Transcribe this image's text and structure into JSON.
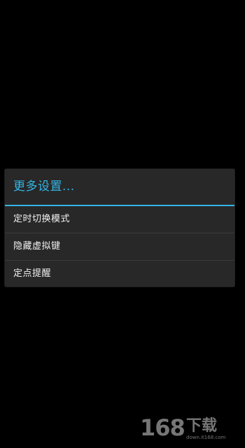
{
  "dialog": {
    "title": "更多设置...",
    "items": [
      {
        "label": "定时切换模式"
      },
      {
        "label": "隐藏虚拟键"
      },
      {
        "label": "定点提醒"
      }
    ]
  },
  "watermark": {
    "number": "168",
    "text": "下载",
    "url": "down.it168.com"
  },
  "colors": {
    "background": "#000000",
    "dialog_background": "#282828",
    "accent": "#33b5e5",
    "divider": "#3a3a3a",
    "item_text": "#f2f2f2"
  }
}
